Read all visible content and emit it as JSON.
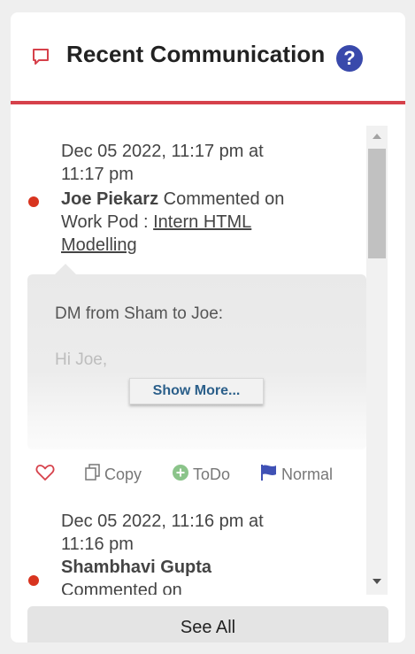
{
  "widget": {
    "title": "Recent Communication",
    "help_glyph": "?",
    "accent_color": "#d6414b",
    "help_color": "#3949ab"
  },
  "entries": [
    {
      "timestamp_line1": "Dec 05 2022, 11:17 pm at",
      "timestamp_line2": "11:17 pm",
      "author": "Joe Piekarz",
      "action": "Commented on",
      "context": "Work Pod :",
      "link_line1": "Intern HTML",
      "link_line2": "Modelling",
      "message_line1": "DM from Sham to Joe:",
      "message_line2": "Hi Joe,",
      "show_more_label": "Show More...",
      "actions": {
        "like_icon": "heart-icon",
        "copy_label": "Copy",
        "todo_label": "ToDo",
        "priority_label": "Normal"
      }
    },
    {
      "timestamp_line1": "Dec 05 2022, 11:16 pm at",
      "timestamp_line2": "11:16 pm",
      "author": "Shambhavi Gupta",
      "action": "Commented on"
    }
  ],
  "footer": {
    "see_all_label": "See All"
  },
  "colors": {
    "status_dot": "#d8341f",
    "todo_green": "#8bc48a",
    "flag_blue": "#3f51b5",
    "show_more_text": "#2b5f8a"
  }
}
